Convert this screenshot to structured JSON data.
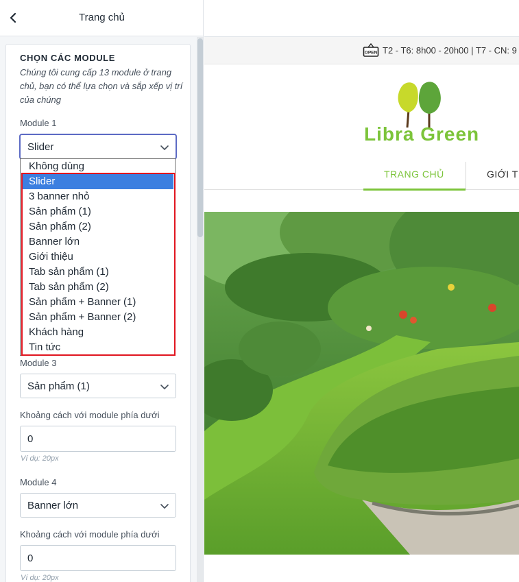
{
  "header": {
    "title": "Trang chủ",
    "back_icon": "chevron-left-icon"
  },
  "modules_section": {
    "heading": "CHỌN CÁC MODULE",
    "description": "Chúng tôi cung cấp 13 module ở trang chủ, bạn có thể lựa chọn và sắp xếp vị trí của chúng",
    "module1": {
      "label": "Module 1",
      "value": "Slider"
    },
    "dropdown_options": [
      "Không dùng",
      "Slider",
      "3 banner nhỏ",
      "Sản phẩm (1)",
      "Sản phẩm (2)",
      "Banner lớn",
      "Giới thiệu",
      "Tab sản phẩm (1)",
      "Tab sản phẩm (2)",
      "Sản phẩm + Banner (1)",
      "Sản phẩm + Banner (2)",
      "Khách hàng",
      "Tin tức"
    ],
    "dropdown_selected": "Slider",
    "module3": {
      "label": "Module 3",
      "value": "Sản phẩm (1)"
    },
    "spacing3": {
      "label": "Khoảng cách với module phía dưới",
      "value": "0",
      "hint": "Ví dụ: 20px"
    },
    "module4": {
      "label": "Module 4",
      "value": "Banner lớn"
    },
    "spacing4": {
      "label": "Khoảng cách với module phía dưới",
      "value": "0",
      "hint": "Ví dụ: 20px"
    }
  },
  "preview": {
    "info_bar": {
      "icon": "open-sign-icon",
      "text": "T2 - T6: 8h00 - 20h00 | T7 - CN: 9"
    },
    "logo": {
      "text": "Libra Green",
      "icon": "tree-logo-icon"
    },
    "nav": {
      "home": "TRANG CHỦ",
      "about": "GIỚI T"
    },
    "hero_icon": "garden-slider-image"
  },
  "colors": {
    "accent_green": "#7cc43a",
    "highlight_red": "#e0141e",
    "selected_blue": "#3c7fe0",
    "focus_purple": "#5c6ac4"
  }
}
